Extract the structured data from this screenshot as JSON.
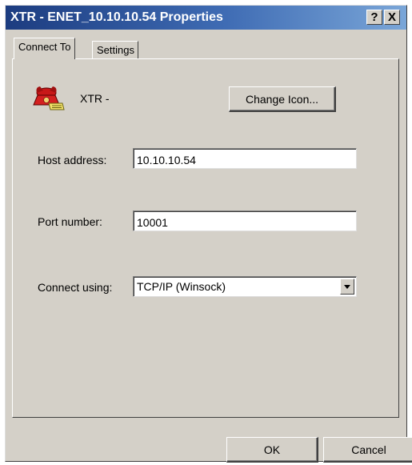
{
  "window": {
    "title": "XTR - ENET_10.10.10.54 Properties",
    "help_glyph": "?",
    "close_glyph": "X"
  },
  "tabs": [
    {
      "label": "Connect To",
      "active": true
    },
    {
      "label": "Settings",
      "active": false
    }
  ],
  "connection": {
    "icon": "phone-icon",
    "name": "XTR -",
    "change_icon_label": "Change Icon..."
  },
  "form": {
    "host_label": "Host address:",
    "host_value": "10.10.10.54",
    "port_label": "Port number:",
    "port_value": "10001",
    "connect_label": "Connect using:",
    "connect_value": "TCP/IP (Winsock)"
  },
  "footer": {
    "ok_label": "OK",
    "cancel_label": "Cancel"
  },
  "colors": {
    "face": "#d4d0c8",
    "title_start": "#1c3c80",
    "title_end": "#7aa6d8"
  }
}
